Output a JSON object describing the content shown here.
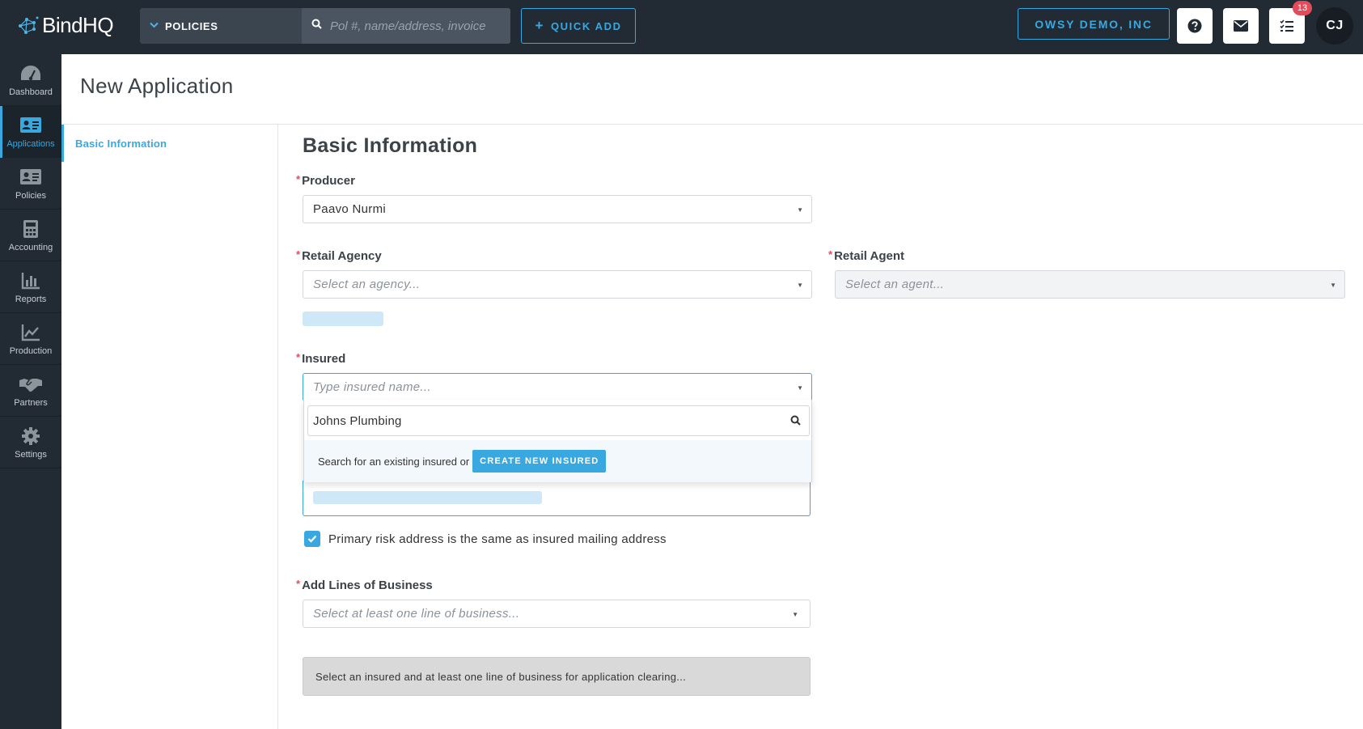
{
  "app": {
    "logo_text": "BindHQ"
  },
  "topbar": {
    "search_type": "POLICIES",
    "search_placeholder": "Pol #, name/address, invoice",
    "quick_add_label": "QUICK ADD",
    "org_name": "OWSY DEMO, INC",
    "notification_count": "13",
    "user_initials": "CJ"
  },
  "sidebar": {
    "items": [
      {
        "label": "Dashboard",
        "icon": "dashboard-icon"
      },
      {
        "label": "Applications",
        "icon": "applications-icon",
        "active": true
      },
      {
        "label": "Policies",
        "icon": "policies-icon"
      },
      {
        "label": "Accounting",
        "icon": "accounting-icon"
      },
      {
        "label": "Reports",
        "icon": "reports-icon"
      },
      {
        "label": "Production",
        "icon": "production-icon"
      },
      {
        "label": "Partners",
        "icon": "partners-icon"
      },
      {
        "label": "Settings",
        "icon": "settings-icon"
      }
    ]
  },
  "page": {
    "title": "New Application",
    "subnav_item": "Basic Information",
    "section_title": "Basic Information"
  },
  "form": {
    "producer": {
      "label": "Producer",
      "value": "Paavo Nurmi"
    },
    "retail_agency": {
      "label": "Retail Agency",
      "placeholder": "Select an agency..."
    },
    "retail_agent": {
      "label": "Retail Agent",
      "placeholder": "Select an agent..."
    },
    "insured": {
      "label": "Insured",
      "placeholder": "Type insured name...",
      "search_value": "Johns Plumbing",
      "search_hint": "Search for an existing insured or",
      "create_label": "CREATE NEW INSURED"
    },
    "same_address_checkbox": {
      "label": "Primary risk address is the same as insured mailing address",
      "checked": true
    },
    "lines_of_business": {
      "label": "Add Lines of Business",
      "placeholder": "Select at least one line of business..."
    },
    "clearing_message": "Select an insured and at least one line of business for application clearing..."
  },
  "colors": {
    "accent": "#39a8e0",
    "topbar": "#222b34",
    "required": "#e34b5b",
    "badge": "#e34b5b"
  }
}
